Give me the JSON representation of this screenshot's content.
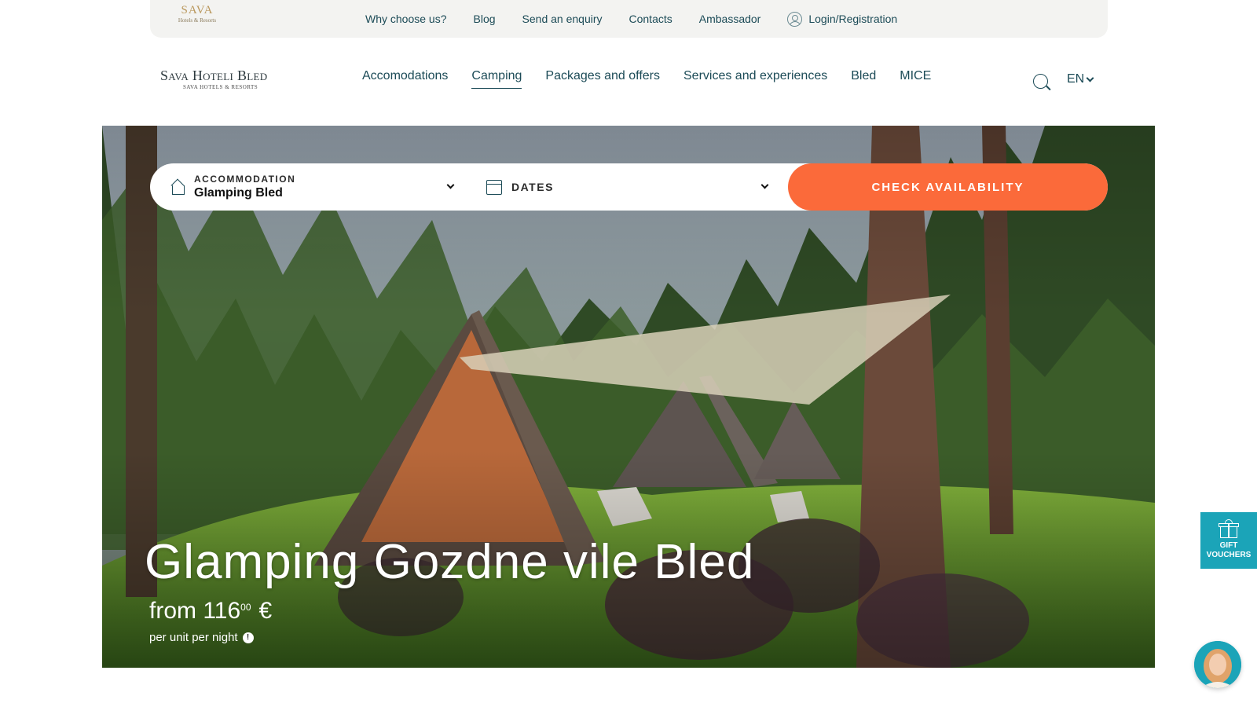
{
  "utility_bar": {
    "logo_mark": "SAVA",
    "logo_sub": "Hotels & Resorts",
    "links": [
      "Why choose us?",
      "Blog",
      "Send an enquiry",
      "Contacts",
      "Ambassador"
    ],
    "login_label": "Login/Registration"
  },
  "header": {
    "brand_name": "Sava Hoteli Bled",
    "brand_sub": "SAVA HOTELS & RESORTS",
    "nav": [
      {
        "label": "Accomodations",
        "active": false
      },
      {
        "label": "Camping",
        "active": true
      },
      {
        "label": "Packages and offers",
        "active": false
      },
      {
        "label": "Services and experiences",
        "active": false
      },
      {
        "label": "Bled",
        "active": false
      },
      {
        "label": "MICE",
        "active": false
      }
    ],
    "language": "EN",
    "search_icon": "search-icon"
  },
  "booking": {
    "accommodation_label": "ACCOMMODATION",
    "accommodation_value": "Glamping Bled",
    "dates_label": "DATES",
    "check_button": "CHECK AVAILABILITY"
  },
  "hero": {
    "title": "Glamping Gozdne vile Bled",
    "price_prefix": "from",
    "price_main": "116",
    "price_cents": "00",
    "price_currency": "€",
    "price_note": "per unit per night",
    "info_icon": "!"
  },
  "gift": {
    "line1": "GIFT",
    "line2": "VOUCHERS"
  },
  "colors": {
    "accent": "#fb6a3a",
    "nav_text": "#1c4b57",
    "gift_bg": "#1ba4b8"
  }
}
